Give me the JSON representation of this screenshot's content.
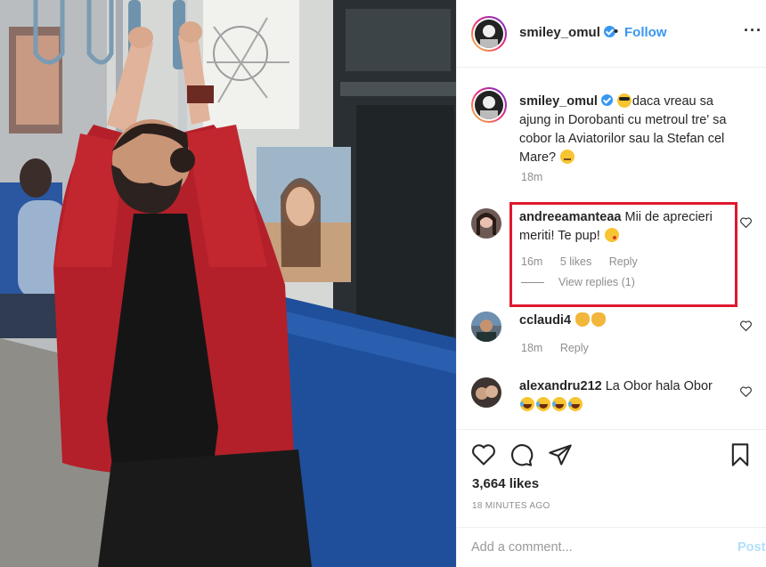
{
  "post": {
    "photo_alt_icon": "photo-metro-man",
    "header": {
      "username": "smiley_omul",
      "separator": "•",
      "follow_label": "Follow",
      "more_icon": "ellipsis-icon"
    },
    "caption": {
      "username": "smiley_omul",
      "text": "daca vreau sa ajung in Dorobanti cu metroul tre' sa cobor la Aviatorilor sau la Stefan cel Mare?",
      "time": "18m"
    },
    "comments": [
      {
        "username": "andreeamanteaa",
        "text": "Mii de aprecieri meriti! Te pup!",
        "time": "16m",
        "likes": "5 likes",
        "reply_label": "Reply",
        "view_replies": "View replies (1)",
        "highlighted": true
      },
      {
        "username": "cclaudi4",
        "text": "",
        "time": "18m",
        "reply_label": "Reply"
      },
      {
        "username": "alexandru212",
        "text": "La Obor hala Obor"
      }
    ],
    "actions": {
      "like_icon": "heart-icon",
      "comment_icon": "comment-bubble-icon",
      "share_icon": "send-icon",
      "save_icon": "bookmark-icon"
    },
    "likes": "3,664 likes",
    "posted_ago": "18 MINUTES AGO",
    "add_comment": {
      "placeholder": "Add a comment...",
      "post_label": "Post"
    }
  },
  "colors": {
    "accent_blue": "#3897f0",
    "highlight_red": "#e0182d",
    "muted_text": "#8e8e8e",
    "jacket_red": "#b3202a",
    "seat_blue": "#1f4f9a"
  }
}
